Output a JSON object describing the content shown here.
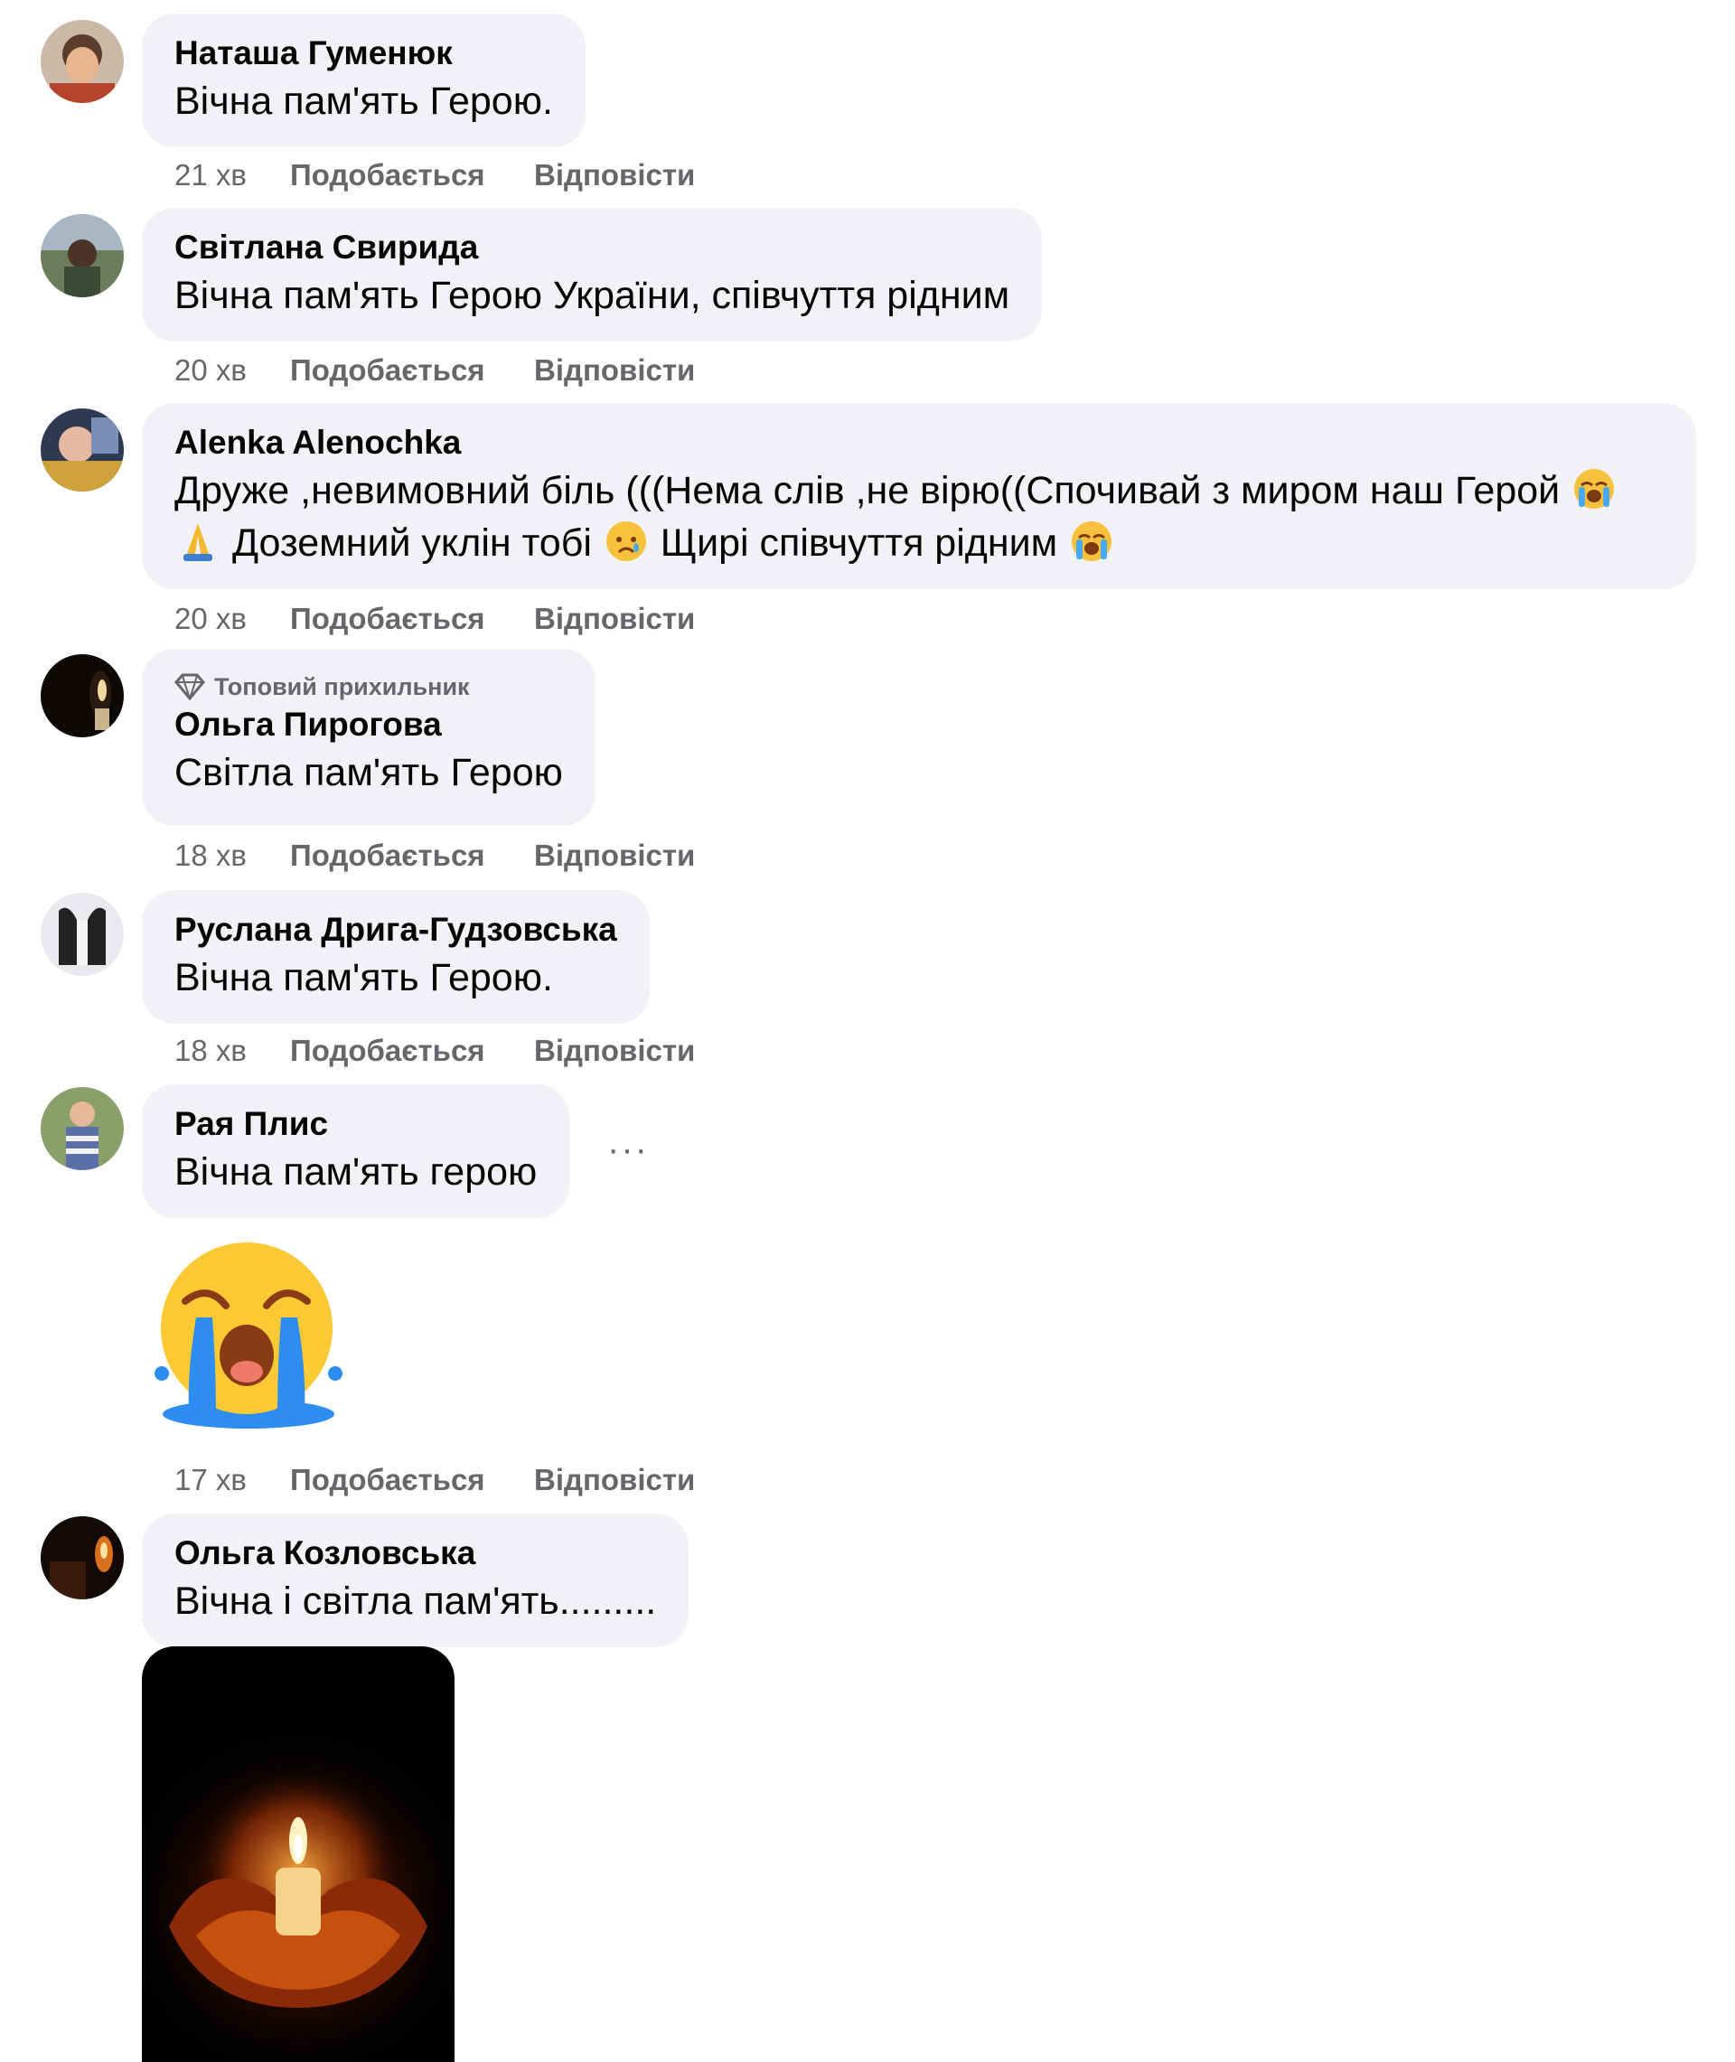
{
  "comments": [
    {
      "author": "Наташа Гуменюк",
      "text": "Вічна пам'ять Герою.",
      "time": "21 хв",
      "like": "Подобається",
      "reply": "Відповісти"
    },
    {
      "author": "Світлана Свирида",
      "text": "Вічна пам'ять Герою України, співчуття рідним",
      "time": "20 хв",
      "like": "Подобається",
      "reply": "Відповісти"
    },
    {
      "author": "Alenka Alenochka",
      "text_part1": "Друже ,невимовний біль (((Нема слів ,не вірю((Спочивай з миром наш Герой",
      "text_part2": "Доземний уклін тобі",
      "text_part3": "Щирі співчуття рідним",
      "time": "20 хв",
      "like": "Подобається",
      "reply": "Відповісти"
    },
    {
      "badge": "Топовий прихильник",
      "author": "Ольга Пирогова",
      "text": "Світла пам'ять Герою",
      "time": "18 хв",
      "like": "Подобається",
      "reply": "Відповісти"
    },
    {
      "author": "Руслана Дрига-Гудзовська",
      "text": "Вічна пам'ять Герою.",
      "time": "18 хв",
      "like": "Подобається",
      "reply": "Відповісти"
    },
    {
      "author": "Рая Плис",
      "text": "Вічна пам'ять герою",
      "more": "···",
      "time": "17 хв",
      "like": "Подобається",
      "reply": "Відповісти"
    },
    {
      "author": "Ольга Козловська",
      "text": "Вічна і світла пам'ять........."
    }
  ],
  "icons": {
    "badge": "diamond-icon",
    "sticker": "loudly-crying-face-sticker",
    "inline_emoji": [
      "loudly-crying-face-emoji",
      "folded-hands-emoji",
      "crying-face-emoji",
      "loudly-crying-face-emoji"
    ]
  },
  "colors": {
    "bubble": "#f0f2f5",
    "meta_text": "#65676b",
    "primary_text": "#050505"
  }
}
